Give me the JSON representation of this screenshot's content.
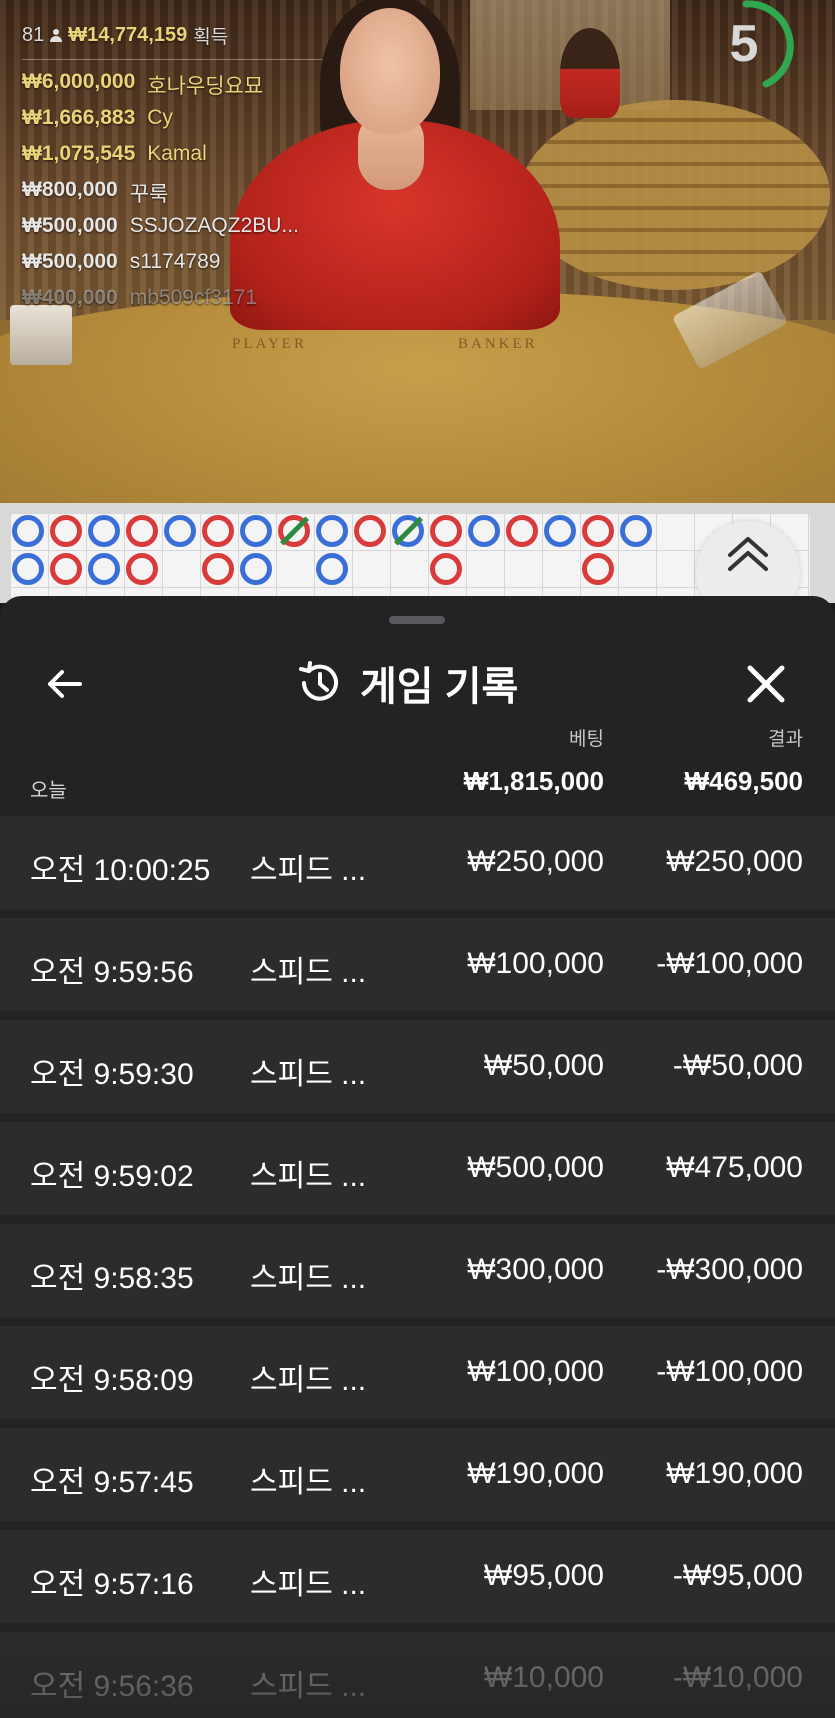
{
  "stream": {
    "player_count": "81",
    "total_won": "₩14,774,159",
    "won_label": "획득",
    "countdown": "5",
    "table_labels": [
      "PLAYER",
      "BANKER"
    ],
    "leaders": [
      {
        "amount": "₩6,000,000",
        "name": "호나우딩요묘"
      },
      {
        "amount": "₩1,666,883",
        "name": "Cy"
      },
      {
        "amount": "₩1,075,545",
        "name": "Kamal"
      },
      {
        "amount": "₩800,000",
        "name": "꾸룩"
      },
      {
        "amount": "₩500,000",
        "name": "SSJOZAQZ2BU..."
      },
      {
        "amount": "₩500,000",
        "name": "s1174789"
      },
      {
        "amount": "₩400,000",
        "name": "mb509cf3171"
      }
    ]
  },
  "road_map": {
    "colors": {
      "player": "#3a6fd8",
      "banker": "#d93a3a",
      "tie": "#2d8a3e"
    }
  },
  "history": {
    "title": "게임 기록",
    "icons": {
      "back": "arrow-left-icon",
      "title": "history-clock-icon",
      "close": "close-icon",
      "expand": "chevron-double-up-icon"
    },
    "columns": {
      "bet": "베팅",
      "result": "결과"
    },
    "today_label": "오늘",
    "today_bet_total": "₩1,815,000",
    "today_result_total": "₩469,500",
    "rows": [
      {
        "time": "오전 10:00:25",
        "game": "스피드 ...",
        "bet": "₩250,000",
        "result": "₩250,000"
      },
      {
        "time": "오전 9:59:56",
        "game": "스피드 ...",
        "bet": "₩100,000",
        "result": "-₩100,000"
      },
      {
        "time": "오전 9:59:30",
        "game": "스피드 ...",
        "bet": "₩50,000",
        "result": "-₩50,000"
      },
      {
        "time": "오전 9:59:02",
        "game": "스피드 ...",
        "bet": "₩500,000",
        "result": "₩475,000"
      },
      {
        "time": "오전 9:58:35",
        "game": "스피드 ...",
        "bet": "₩300,000",
        "result": "-₩300,000"
      },
      {
        "time": "오전 9:58:09",
        "game": "스피드 ...",
        "bet": "₩100,000",
        "result": "-₩100,000"
      },
      {
        "time": "오전 9:57:45",
        "game": "스피드 ...",
        "bet": "₩190,000",
        "result": "₩190,000"
      },
      {
        "time": "오전 9:57:16",
        "game": "스피드 ...",
        "bet": "₩95,000",
        "result": "-₩95,000"
      },
      {
        "time": "오전 9:56:36",
        "game": "스피드 ...",
        "bet": "₩10,000",
        "result": "-₩10,000"
      }
    ]
  }
}
